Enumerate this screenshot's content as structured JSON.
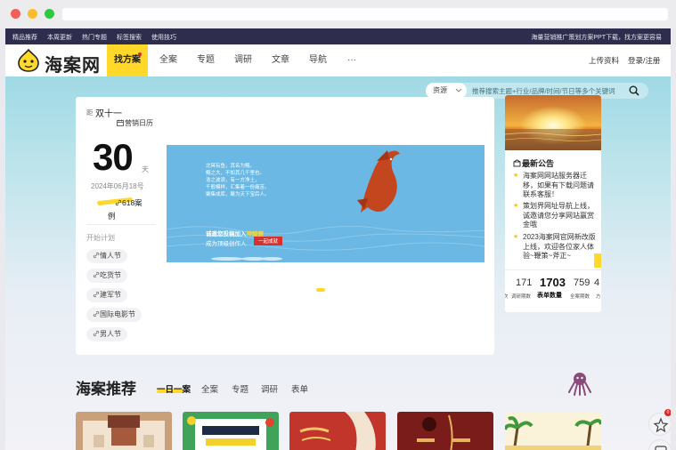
{
  "topbar": {
    "links": [
      "精品推荐",
      "本周更新",
      "热门专题",
      "标签搜索",
      "使用技巧"
    ],
    "promo": "海量营销推广策划方案PPT下载，找方案更容易"
  },
  "nav": {
    "logo_text": "海案网",
    "highlight": "找方案",
    "items": [
      "全案",
      "专题",
      "调研",
      "文章",
      "导航",
      "···"
    ],
    "upload": "上传资料",
    "login": "登录/注册"
  },
  "search": {
    "type": "资源",
    "placeholder": "推荐搜索主题+行业/品牌/时间/节日等多个关键词"
  },
  "calendar": {
    "countdown_prefix": "距",
    "festival": "双十一",
    "calendar_link": "营销日历",
    "days": "30",
    "days_unit": "天",
    "date": "2024年06月18号",
    "case_count": "618案",
    "case_suffix": "例",
    "plan_title": "开始计划",
    "tags": [
      "情人节",
      "吃货节",
      "建军节",
      "国际电影节",
      "男人节"
    ]
  },
  "banner": {
    "lines": [
      "北冥有鱼，其名为鲲。",
      "鲲之大，不知其几千里也。",
      "",
      "浩之波浪，有一方净土，",
      "千般模样，汇集着一份痛苦。",
      "聚集成库，聚为天下宝后人。"
    ],
    "cta_line1_prefix": "诚邀您投稿加入",
    "cta_line1_brand": "神鲸赛",
    "cta_line2": "成为顶级创作人",
    "cta_button": "一起成就"
  },
  "notices": {
    "title": "最新公告",
    "items": [
      "海案网网站服务器迁移，如果有下载问题请联系客服！",
      "策划界网址导航上线，诚邀请您分享网站赢赏金哦",
      "2023海案网官网新改版上线，欢迎各位家人体验~鞭策~斧正~"
    ]
  },
  "stats": [
    {
      "value": "171",
      "label": "次"
    },
    {
      "value": "",
      "label": "调研期数"
    },
    {
      "value": "1703",
      "label": "表单数量"
    },
    {
      "value": "759",
      "label": "全案期数"
    },
    {
      "value": "4",
      "label": "方"
    }
  ],
  "recommend": {
    "title": "海案推荐",
    "tabs": [
      "一日一案",
      "全案",
      "专题",
      "调研",
      "表单"
    ]
  },
  "colors": {
    "brand_yellow": "#ffd829",
    "top_strip": "#2f2d4d",
    "banner_blue": "#6ab8e3",
    "accent_red": "#d8302b"
  },
  "float_badge": "0"
}
